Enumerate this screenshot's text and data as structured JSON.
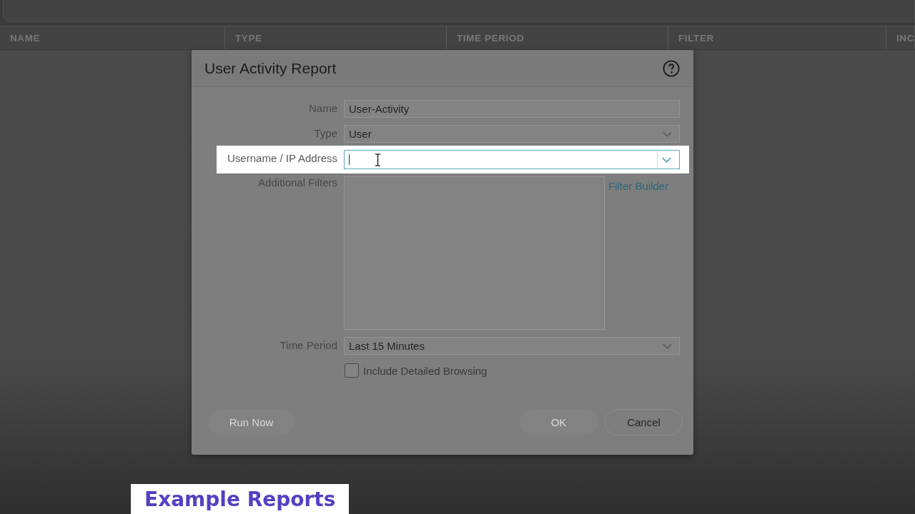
{
  "table": {
    "columns": [
      "NAME",
      "TYPE",
      "TIME PERIOD",
      "FILTER",
      "INC"
    ]
  },
  "dialog": {
    "title": "User Activity Report",
    "fields": [
      {
        "kind": "text",
        "label": "Name",
        "value": "User-Activity",
        "highlighted": false
      },
      {
        "kind": "select",
        "label": "Type",
        "value": "User",
        "highlighted": false
      },
      {
        "kind": "combo",
        "label": "Username / IP Address",
        "highlighted": true
      },
      {
        "kind": "filter",
        "label": "Additional Filters",
        "link": "Filter Builder",
        "highlighted": false
      },
      {
        "kind": "select",
        "label": "Time Period",
        "value": "Last 15 Minutes",
        "highlighted": false
      },
      {
        "kind": "checkbox",
        "label": "Include Detailed Browsing",
        "checked": false,
        "highlighted": false
      }
    ],
    "buttons": [
      {
        "label": "Run Now",
        "disabled": true
      },
      {
        "label": "OK",
        "disabled": true
      },
      {
        "label": "Cancel",
        "disabled": false
      }
    ]
  },
  "caption": "Example Reports"
}
